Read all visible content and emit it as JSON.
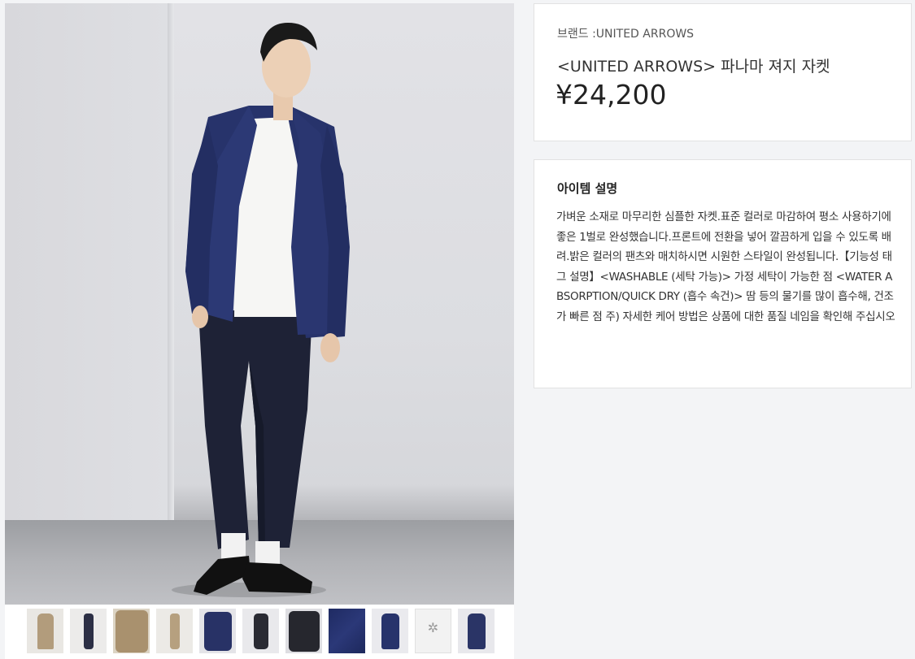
{
  "product": {
    "brand_label": "브랜드 :UNITED ARROWS",
    "name": "<UNITED ARROWS> 파나마 져지 자켓",
    "price": "¥24,200"
  },
  "description": {
    "title": "아이템 설명",
    "body": "가벼운 소재로 마무리한 심플한 자켓.표준 컬러로 마감하여 평소 사용하기에 좋은 1벌로 완성했습니다.프론트에 전환을 넣어 깔끔하게 입을 수 있도록 배려.밝은 컬러의 팬츠와 매치하시면 시원한 스타일이 완성됩니다.【기능성 태그 설명】<WASHABLE (세탁 가능)> 가정 세탁이 가능한 점 <WATER ABSORPTION/QUICK DRY (흡수 속건)> 땀 등의 물기를 많이 흡수해, 건조가 빠른 점 주) 자세한 케어 방법은 상품에 대한 품질 네임을 확인해 주십시오"
  },
  "gallery": {
    "main_image_icon": "product-photo-navy-jacket",
    "thumbnails": [
      {
        "icon": "beige-jacket-model-thumbnail",
        "color": "#b29c7c"
      },
      {
        "icon": "navy-full-body-thumbnail",
        "color": "#2c2f45"
      },
      {
        "icon": "beige-jacket-detail-thumbnail",
        "color": "#a9916e"
      },
      {
        "icon": "beige-full-body-thumbnail",
        "color": "#b6a07f"
      },
      {
        "icon": "navy-jacket-detail-thumbnail",
        "color": "#283266"
      },
      {
        "icon": "dark-jacket-model-thumbnail",
        "color": "#2a2b33"
      },
      {
        "icon": "dark-jacket-detail-thumbnail",
        "color": "#26272e"
      },
      {
        "icon": "navy-fabric-closeup-thumbnail",
        "color": "#1f2b63"
      },
      {
        "icon": "navy-jacket-front-thumbnail",
        "color": "#27336b"
      },
      {
        "icon": "care-label-thumbnail",
        "color": "#e6e6e6"
      },
      {
        "icon": "navy-jacket-model-thumbnail",
        "color": "#2a3466"
      }
    ]
  }
}
